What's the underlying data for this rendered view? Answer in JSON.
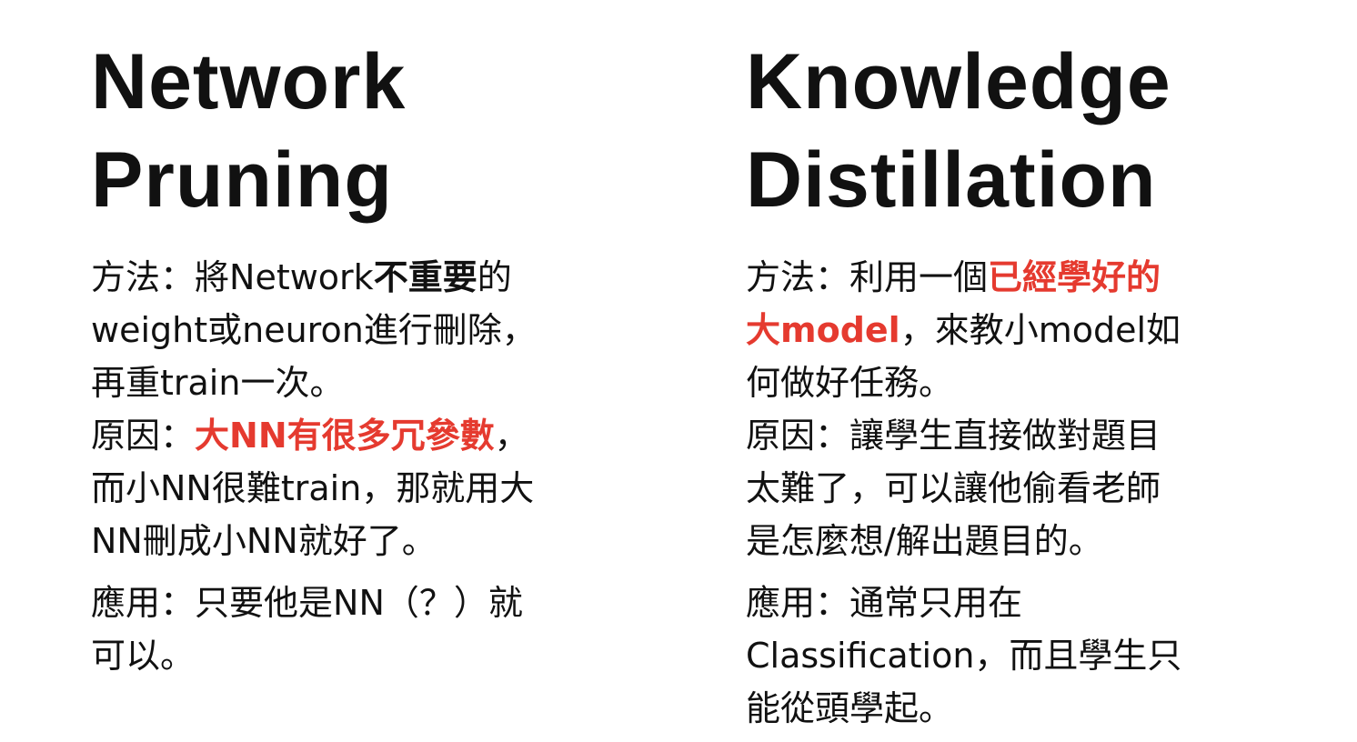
{
  "left": {
    "title_line1": "Network",
    "title_line2": "Pruning",
    "method": {
      "label": "方法：",
      "text_a": "將Network",
      "bold": "不重要",
      "text_b": "的",
      "text_c": "weight或neuron進行刪除，",
      "text_d": "再重train一次。"
    },
    "reason": {
      "label": "原因：",
      "highlight": "大NN有很多冗參數",
      "text_a": "，",
      "text_b": "而小NN很難train，那就用大",
      "text_c": "NN刪成小NN就好了。"
    },
    "application": {
      "label": "應用：",
      "text_a": "只要他是NN（？）就",
      "text_b": "可以。"
    }
  },
  "right": {
    "title_line1": "Knowledge",
    "title_line2": "Distillation",
    "method": {
      "label": "方法：",
      "text_a": "利用一個",
      "highlight_a": "已經學好的",
      "highlight_b": "大model",
      "text_b": "，來教小model如",
      "text_c": "何做好任務。"
    },
    "reason": {
      "label": "原因：",
      "text_a": "讓學生直接做對題目",
      "text_b": "太難了，可以讓他偷看老師",
      "text_c": "是怎麼想/解出題目的。"
    },
    "application": {
      "label": "應用：",
      "text_a": "通常只用在",
      "text_b": "Classification，而且學生只",
      "text_c": "能從頭學起。"
    }
  },
  "colors": {
    "text": "#111111",
    "highlight": "#e53a2f",
    "background": "#ffffff"
  }
}
